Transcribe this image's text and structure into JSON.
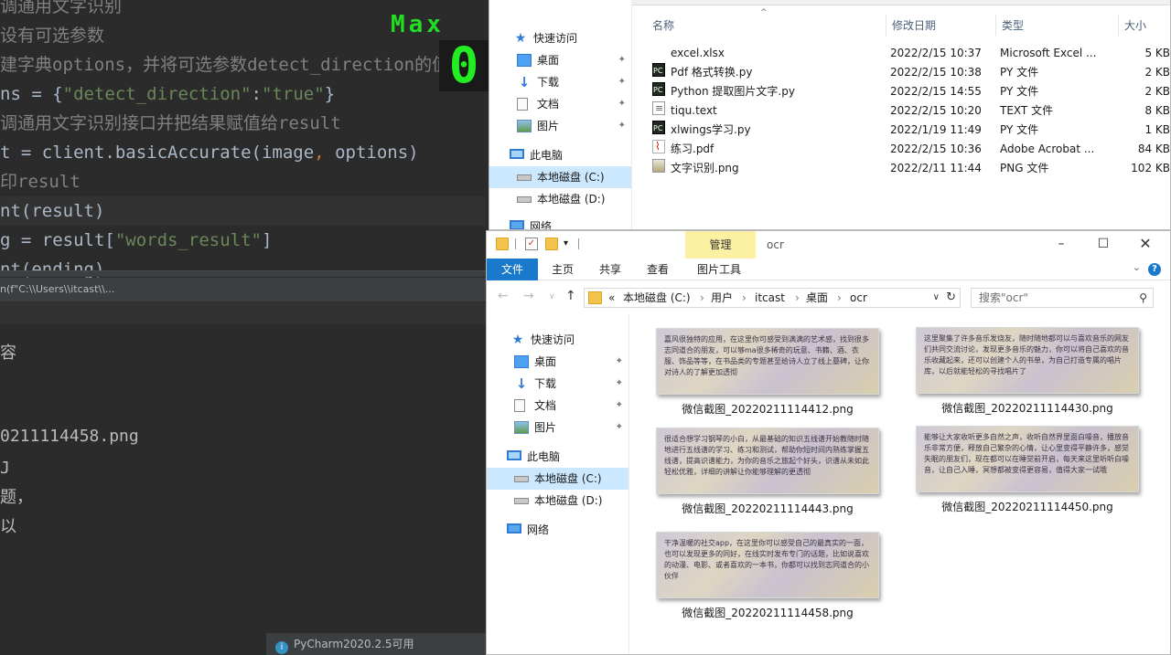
{
  "ide": {
    "code_lines": [
      {
        "text": "调通用文字识别",
        "comment": true
      },
      {
        "text": "设有可选参数",
        "comment": true
      },
      {
        "text": "建字典options，并将可选参数detect_direction的值设",
        "comment": true
      },
      {
        "text": "ns = {\"detect_direction\":\"true\"}",
        "comment": false
      },
      {
        "text": "调通用文字识别接口并把结果赋值给result",
        "comment": true
      },
      {
        "text": "t = client.basicAccurate(image, options)",
        "comment": false
      },
      {
        "text": "印result",
        "comment": true
      },
      {
        "text": "nt(result)",
        "comment": false
      },
      {
        "text": "g = result[\"words_result\"]",
        "comment": false
      },
      {
        "text": "nt(ending)",
        "comment": false
      }
    ],
    "run_bar_text": "n(f\"C:\\\\Users\\\\itcast\\\\...",
    "output_lines": [
      "容",
      "0211114458.png",
      "J",
      "题，",
      "以"
    ],
    "notification": "PyCharm2020.2.5可用"
  },
  "overlay": {
    "label": "Max",
    "value": "0"
  },
  "top_explorer": {
    "columns": {
      "name": "名称",
      "modified": "修改日期",
      "type": "类型",
      "size": "大小"
    },
    "nav": [
      {
        "label": "快速访问",
        "icon": "star-icon"
      },
      {
        "label": "桌面",
        "icon": "desktop-icon",
        "pinned": true
      },
      {
        "label": "下载",
        "icon": "download-icon",
        "pinned": true
      },
      {
        "label": "文档",
        "icon": "document-icon",
        "pinned": true
      },
      {
        "label": "图片",
        "icon": "pictures-icon",
        "pinned": true
      },
      {
        "label": "此电脑",
        "icon": "this-pc-icon"
      },
      {
        "label": "本地磁盘 (C:)",
        "icon": "disk-icon",
        "selected": true
      },
      {
        "label": "本地磁盘 (D:)",
        "icon": "disk-icon"
      },
      {
        "label": "网络",
        "icon": "network-icon"
      }
    ],
    "files": [
      {
        "name": "excel.xlsx",
        "modified": "2022/2/15 10:37",
        "type": "Microsoft Excel ...",
        "size": "5 KB",
        "icon": "xlsx"
      },
      {
        "name": "Pdf 格式转换.py",
        "modified": "2022/2/15 10:38",
        "type": "PY 文件",
        "size": "2 KB",
        "icon": "py"
      },
      {
        "name": "Python 提取图片文字.py",
        "modified": "2022/2/15 14:55",
        "type": "PY 文件",
        "size": "2 KB",
        "icon": "py"
      },
      {
        "name": "tiqu.text",
        "modified": "2022/2/15 10:20",
        "type": "TEXT 文件",
        "size": "8 KB",
        "icon": "txt"
      },
      {
        "name": "xlwings学习.py",
        "modified": "2022/1/19 11:49",
        "type": "PY 文件",
        "size": "1 KB",
        "icon": "py"
      },
      {
        "name": "练习.pdf",
        "modified": "2022/2/15 10:36",
        "type": "Adobe Acrobat ...",
        "size": "84 KB",
        "icon": "pdf"
      },
      {
        "name": "文字识别.png",
        "modified": "2022/2/11 11:44",
        "type": "PNG 文件",
        "size": "102 KB",
        "icon": "png"
      }
    ]
  },
  "ocr_explorer": {
    "title": "ocr",
    "manage_tab": "管理",
    "ribbon_tabs": [
      "文件",
      "主页",
      "共享",
      "查看",
      "图片工具"
    ],
    "breadcrumb": [
      "«",
      "本地磁盘 (C:)",
      "用户",
      "itcast",
      "桌面",
      "ocr"
    ],
    "search_placeholder": "搜索\"ocr\"",
    "nav": [
      {
        "label": "快速访问",
        "icon": "star-icon"
      },
      {
        "label": "桌面",
        "icon": "desktop-icon",
        "pinned": true
      },
      {
        "label": "下载",
        "icon": "download-icon",
        "pinned": true
      },
      {
        "label": "文档",
        "icon": "document-icon",
        "pinned": true
      },
      {
        "label": "图片",
        "icon": "pictures-icon",
        "pinned": true
      },
      {
        "label": "此电脑",
        "icon": "this-pc-icon"
      },
      {
        "label": "本地磁盘 (C:)",
        "icon": "disk-icon",
        "selected": true
      },
      {
        "label": "本地磁盘 (D:)",
        "icon": "disk-icon"
      },
      {
        "label": "网络",
        "icon": "network-icon"
      }
    ],
    "thumbnails": [
      {
        "caption": "微信截图_20220211114412.png",
        "text": "嘉风很独特的应用，在这里你可感受到满满的艺术感，找到很多志同道合的朋友，可以够ma很多稀奇的玩意、书籍、酒、衣服、饰品等等，在书品类的专题甚至给诗人立了线上墓碑，让你对诗人的了解更加透彻"
      },
      {
        "caption": "微信截图_20220211114430.png",
        "text": "这里聚集了许多音乐发烧友，随时随地都可以与喜欢音乐的网友们共同交流讨论，发现更多音乐的魅力，你可以将自己喜欢的音乐收藏起来，还可以创建个人的书单，为自己打造专属的唱片库，以后就能轻松的寻找唱片了"
      },
      {
        "caption": "微信截图_20220211114443.png",
        "text": "很适合想学习钢琴的小白，从最基础的知识五线谱开始教随时随地进行五线谱的学习、练习和测试，帮助你短时间内熟练掌握五线谱，提高识谱能力，为你的音乐之旅起个好头，识谱从未如此轻松优雅，详细的讲解让你能够理解的更透彻"
      },
      {
        "caption": "微信截图_20220211114450.png",
        "text": "能够让大家收听更多自然之声，收听自然界里面白噪音，播放音乐非常方便，释放自己繁杂的心情，让心里变得平静许多，感觉失眠的朋友们，现在都可以在睡觉前开启，每天来这里听听白噪音，让自己入睡，冥想都被变得更容易，值得大家一试哦"
      },
      {
        "caption": "微信截图_20220211114458.png",
        "text": "干净温暖的社交app，在这里你可以感受自己的最真实的一面，也可以发现更多的同好，在线实时发布专门的话题，比如说喜欢的动漫、电影、或者喜欢的一本书，你都可以找到志同道合的小伙伴"
      }
    ]
  }
}
